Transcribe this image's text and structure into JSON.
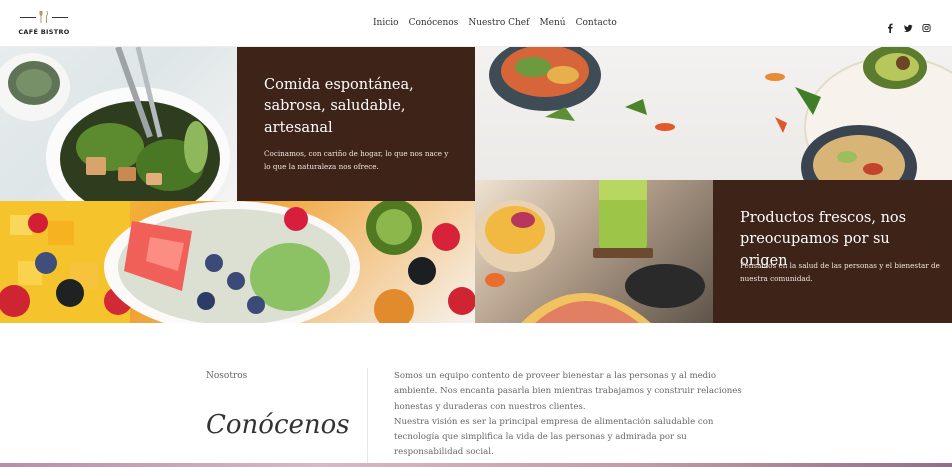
{
  "brand": {
    "name": "CAFÉ BISTRO",
    "logo_icon": "cutlery-icon"
  },
  "nav": {
    "items": [
      "Inicio",
      "Conócenos",
      "Nuestro Chef",
      "Menú",
      "Contacto"
    ]
  },
  "social": {
    "items": [
      {
        "name": "facebook",
        "icon": "facebook-icon"
      },
      {
        "name": "twitter",
        "icon": "twitter-icon"
      },
      {
        "name": "instagram",
        "icon": "instagram-icon"
      }
    ]
  },
  "hero": {
    "panel1": {
      "title": "Comida espontánea, sabrosa, saludable, artesanal",
      "text": "Cocinamos, con cariño de hogar, lo que nos nace y lo que la naturaleza nos ofrece."
    },
    "panel2": {
      "title": "Productos frescos, nos preocupamos por su origen",
      "text": "Pensamos en la salud de las personas y el bienestar de nuestra comunidad."
    },
    "panel_color": "#3e2318"
  },
  "about": {
    "label": "Nosotros",
    "title": "Conócenos",
    "paragraphs": [
      "Somos un equipo contento de proveer bienestar a las personas y al medio ambiente. Nos encanta pasarla bien mientras trabajamos y construir relaciones honestas y duraderas con nuestros clientes.",
      "Nuestra visión es ser la principal empresa de alimentación saludable con tecnología que simplifica la vida de las personas y admirada por su responsabilidad social."
    ]
  }
}
